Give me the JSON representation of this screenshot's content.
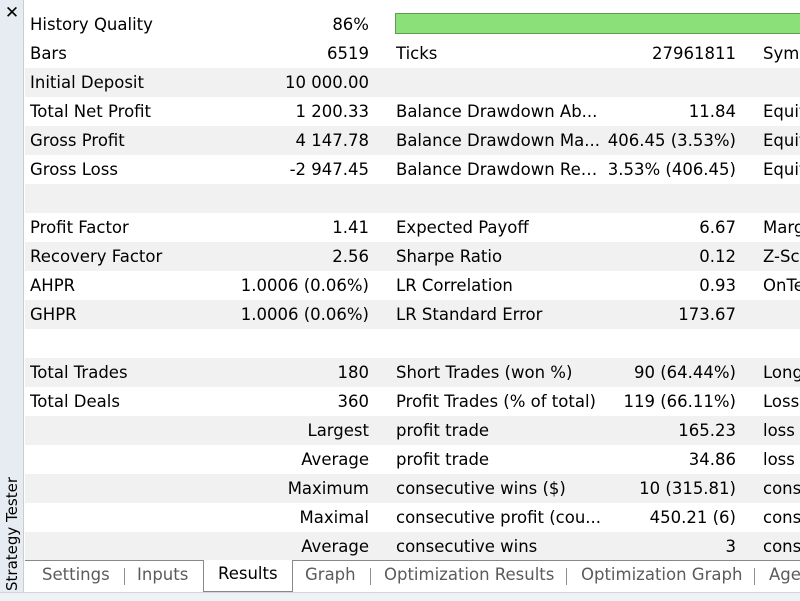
{
  "panel": {
    "title": "Strategy Tester",
    "close_glyph": "✕"
  },
  "history_quality": {
    "label": "History Quality",
    "value": "86%",
    "fraction": 0.86,
    "color": "#8ce07a"
  },
  "rows": [
    {
      "label1": "Bars",
      "value1": "6519",
      "label2": "Ticks",
      "value2": "27961811",
      "label3": "Symb",
      "shade": false
    },
    {
      "label1": "Initial Deposit",
      "value1": "10 000.00",
      "label2": "",
      "value2": "",
      "label3": "",
      "shade": true
    },
    {
      "label1": "Total Net Profit",
      "value1": "1 200.33",
      "label2": "Balance Drawdown Ab...",
      "value2": "11.84",
      "label3": "Equit",
      "shade": false
    },
    {
      "label1": "Gross Profit",
      "value1": "4 147.78",
      "label2": "Balance Drawdown Ma...",
      "value2": "406.45 (3.53%)",
      "label3": "Equit",
      "shade": true
    },
    {
      "label1": "Gross Loss",
      "value1": "-2 947.45",
      "label2": "Balance Drawdown Rel...",
      "value2": "3.53% (406.45)",
      "label3": "Equit",
      "shade": false
    },
    {
      "label1": "",
      "value1": "",
      "label2": "",
      "value2": "",
      "label3": "",
      "shade": true
    },
    {
      "label1": "Profit Factor",
      "value1": "1.41",
      "label2": "Expected Payoff",
      "value2": "6.67",
      "label3": "Marg",
      "shade": false
    },
    {
      "label1": "Recovery Factor",
      "value1": "2.56",
      "label2": "Sharpe Ratio",
      "value2": "0.12",
      "label3": "Z-Sc",
      "shade": true
    },
    {
      "label1": "AHPR",
      "value1": "1.0006 (0.06%)",
      "label2": "LR Correlation",
      "value2": "0.93",
      "label3": "OnTe",
      "shade": false
    },
    {
      "label1": "GHPR",
      "value1": "1.0006 (0.06%)",
      "label2": "LR Standard Error",
      "value2": "173.67",
      "label3": "",
      "shade": true
    },
    {
      "label1": "",
      "value1": "",
      "label2": "",
      "value2": "",
      "label3": "",
      "shade": false
    },
    {
      "label1": "Total Trades",
      "value1": "180",
      "label2": "Short Trades (won %)",
      "value2": "90 (64.44%)",
      "label3": "Long",
      "shade": true
    },
    {
      "label1": "Total Deals",
      "value1": "360",
      "label2": "Profit Trades (% of total)",
      "value2": "119 (66.11%)",
      "label3": "Loss",
      "shade": false
    },
    {
      "label1": "",
      "value1": "Largest",
      "label2": "profit trade",
      "value2": "165.23",
      "label3": "loss t",
      "shade": true
    },
    {
      "label1": "",
      "value1": "Average",
      "label2": "profit trade",
      "value2": "34.86",
      "label3": "loss t",
      "shade": false
    },
    {
      "label1": "",
      "value1": "Maximum",
      "label2": "consecutive wins ($)",
      "value2": "10 (315.81)",
      "label3": "cons",
      "shade": true
    },
    {
      "label1": "",
      "value1": "Maximal",
      "label2": "consecutive profit (cou...",
      "value2": "450.21 (6)",
      "label3": "cons",
      "shade": false
    },
    {
      "label1": "",
      "value1": "Average",
      "label2": "consecutive wins",
      "value2": "3",
      "label3": "cons",
      "shade": true
    }
  ],
  "tabs": [
    {
      "label": "Settings",
      "active": false
    },
    {
      "label": "Inputs",
      "active": false
    },
    {
      "label": "Results",
      "active": true
    },
    {
      "label": "Graph",
      "active": false
    },
    {
      "label": "Optimization Results",
      "active": false
    },
    {
      "label": "Optimization Graph",
      "active": false
    },
    {
      "label": "Age",
      "active": false
    }
  ]
}
